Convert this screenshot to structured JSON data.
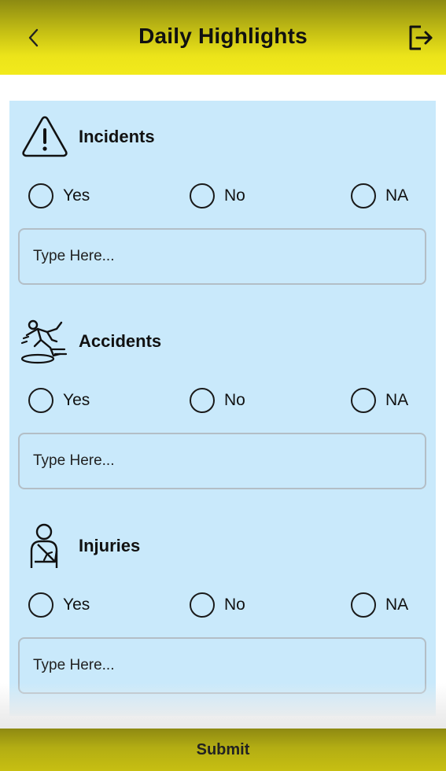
{
  "header": {
    "title": "Daily Highlights",
    "back_icon": "chevron-left-icon",
    "logout_icon": "logout-icon"
  },
  "sections": [
    {
      "title": "Incidents",
      "icon": "warning-icon",
      "options": [
        "Yes",
        "No",
        "NA"
      ],
      "input_placeholder": "Type Here..."
    },
    {
      "title": "Accidents",
      "icon": "slip-fall-icon",
      "options": [
        "Yes",
        "No",
        "NA"
      ],
      "input_placeholder": "Type Here..."
    },
    {
      "title": "Injuries",
      "icon": "arm-sling-icon",
      "options": [
        "Yes",
        "No",
        "NA"
      ],
      "input_placeholder": "Type Here..."
    }
  ],
  "footer": {
    "submit_label": "Submit"
  },
  "colors": {
    "header_accent": "#ece41a",
    "panel_bg": "#c9e9fb",
    "footer_bg": "#b3ad13"
  }
}
